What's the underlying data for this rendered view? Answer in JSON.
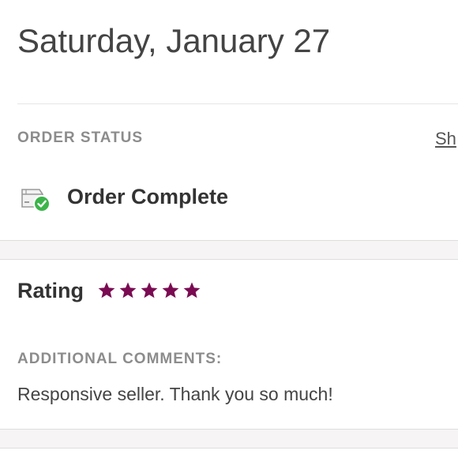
{
  "order": {
    "date": "Saturday, January 27",
    "status_heading": "ORDER STATUS",
    "show_link": "Sh",
    "status": "Order Complete",
    "status_icon": "package-check-icon"
  },
  "review": {
    "rating_label": "Rating",
    "rating_value": 5,
    "rating_max": 5,
    "star_icon": "star-icon",
    "star_color": "#7a0b52",
    "comments_heading": "ADDITIONAL COMMENTS:",
    "comment": "Responsive seller. Thank you so much!"
  },
  "colors": {
    "success": "#3bb54a",
    "accent": "#7a0b52"
  }
}
